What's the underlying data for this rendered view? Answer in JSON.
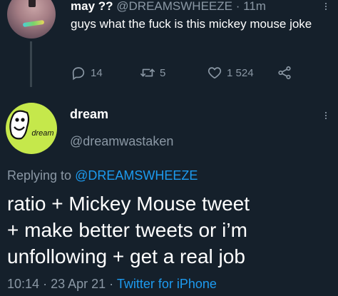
{
  "parent_tweet": {
    "display_name": "may ??",
    "handle": "@DREAMSWHEEZE",
    "separator": "·",
    "time_ago": "11m",
    "text": "guys what the fuck is this mickey mouse joke",
    "replies": "14",
    "retweets": "5",
    "likes": "1 524",
    "more_icon": "more-vertical-icon"
  },
  "main_tweet": {
    "display_name": "dream",
    "handle": "@dreamwastaken",
    "avatar_text": "dream",
    "replying_prefix": "Replying to",
    "replying_handle": "@DREAMSWHEEZE",
    "lines": [
      "ratio + Mickey Mouse tweet",
      "+ make better tweets or i’m",
      "unfollowing + get a real job"
    ],
    "time": "10:14",
    "date": "23 Apr 21",
    "separator": "·",
    "source": "Twitter for iPhone"
  },
  "colors": {
    "background": "#15202b",
    "text": "#ffffff",
    "secondary": "#8b98a5",
    "link": "#1d9bf0",
    "avatar_green": "#c5e84b"
  }
}
